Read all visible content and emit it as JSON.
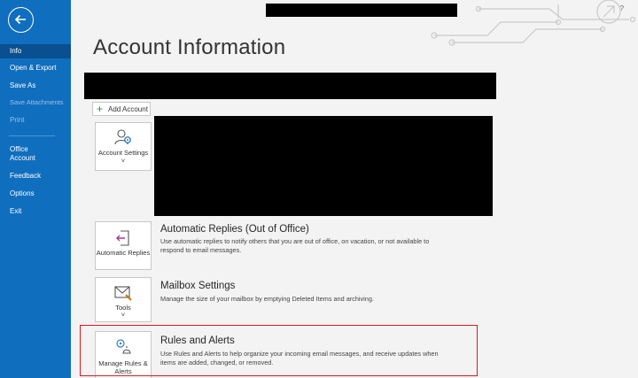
{
  "sidebar": {
    "items": [
      {
        "label": "Info"
      },
      {
        "label": "Open & Export"
      },
      {
        "label": "Save As"
      },
      {
        "label": "Save Attachments"
      },
      {
        "label": "Print"
      },
      {
        "label": "Office Account"
      },
      {
        "label": "Feedback"
      },
      {
        "label": "Options"
      },
      {
        "label": "Exit"
      }
    ]
  },
  "header": {
    "help": "?"
  },
  "main": {
    "title": "Account Information",
    "add_account_label": "Add Account",
    "account_settings": {
      "label": "Account Settings"
    },
    "automatic_replies": {
      "tile_label": "Automatic Replies",
      "title": "Automatic Replies (Out of Office)",
      "description": "Use automatic replies to notify others that you are out of office, on vacation, or not available to respond to email messages."
    },
    "mailbox_settings": {
      "tile_label": "Tools",
      "title": "Mailbox Settings",
      "description": "Manage the size of your mailbox by emptying Deleted Items and archiving."
    },
    "rules_alerts": {
      "tile_label": "Manage Rules & Alerts",
      "title": "Rules and Alerts",
      "description": "Use Rules and Alerts to help organize your incoming email messages, and receive updates when items are added, changed, or removed."
    }
  },
  "colors": {
    "sidebar": "#106ebe",
    "highlight": "#d71920"
  }
}
